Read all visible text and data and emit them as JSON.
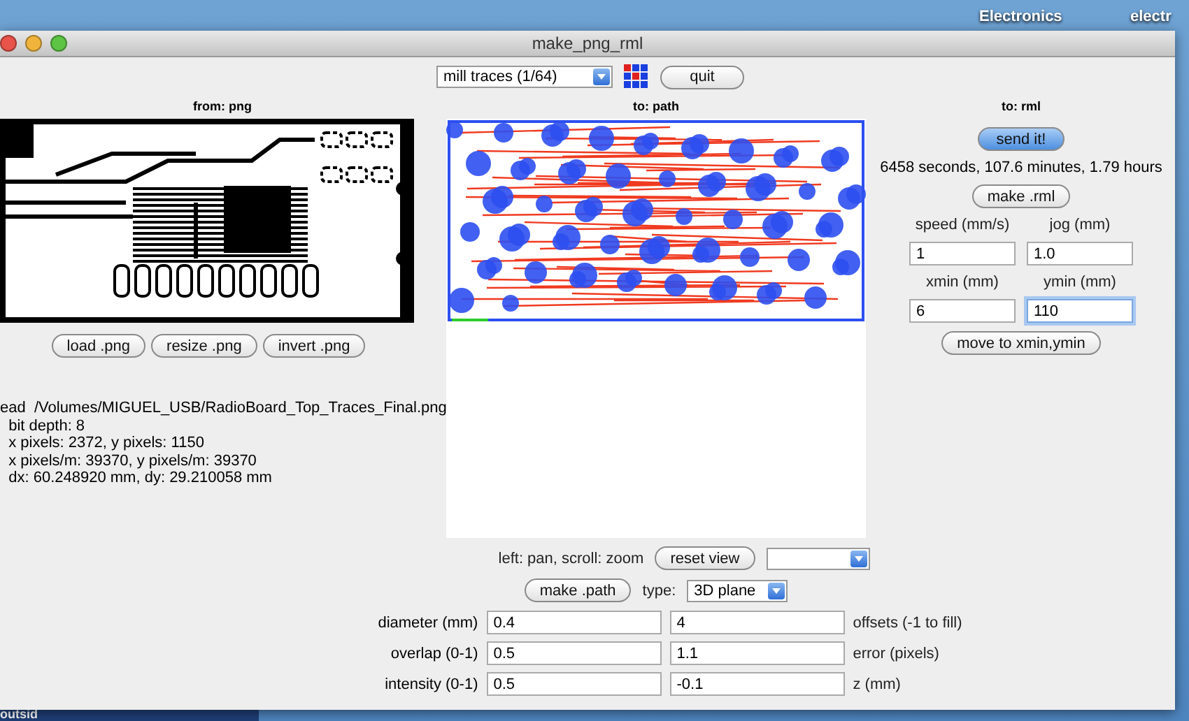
{
  "desktop": {
    "icons": [
      {
        "label": "Electronics"
      },
      {
        "label": "electr"
      }
    ],
    "terminal_text": "outsid"
  },
  "window": {
    "title": "make_png_rml"
  },
  "toolbar": {
    "mode": "mill traces (1/64)",
    "quit": "quit"
  },
  "from_png": {
    "heading": "from: png",
    "buttons": [
      "load .png",
      "resize .png",
      "invert .png"
    ],
    "info": [
      "ead  /Volumes/MIGUEL_USB/RadioBoard_Top_Traces_Final.png",
      "  bit depth: 8",
      "  x pixels: 2372, y pixels: 1150",
      "  x pixels/m: 39370, y pixels/m: 39370",
      "  dx: 60.248920 mm, dy: 29.210058 mm"
    ]
  },
  "to_path": {
    "heading": "to: path",
    "hint": "left: pan, scroll: zoom",
    "reset": "reset view",
    "make": "make .path",
    "type_label": "type:",
    "type_value": "3D plane",
    "params": [
      {
        "label": "diameter (mm)",
        "value": "0.4",
        "value_2": "4",
        "label_2": "offsets (-1 to fill)"
      },
      {
        "label": "overlap (0-1)",
        "value": "0.5",
        "value_2": "1.1",
        "label_2": "error (pixels)"
      },
      {
        "label": "intensity (0-1)",
        "value": "0.5",
        "value_2": "-0.1",
        "label_2": "z (mm)"
      }
    ]
  },
  "to_rml": {
    "heading": "to: rml",
    "send": "send it!",
    "estimate": "6458 seconds, 107.6 minutes, 1.79 hours",
    "make": "make .rml",
    "fields": [
      [
        {
          "label": "speed (mm/s)",
          "value": "1",
          "focused": false
        },
        {
          "label": "jog (mm)",
          "value": "1.0",
          "focused": false
        }
      ],
      [
        {
          "label": "xmin (mm)",
          "value": "6",
          "focused": false
        },
        {
          "label": "ymin (mm)",
          "value": "110",
          "focused": true
        }
      ]
    ],
    "move": "move to xmin,ymin"
  }
}
